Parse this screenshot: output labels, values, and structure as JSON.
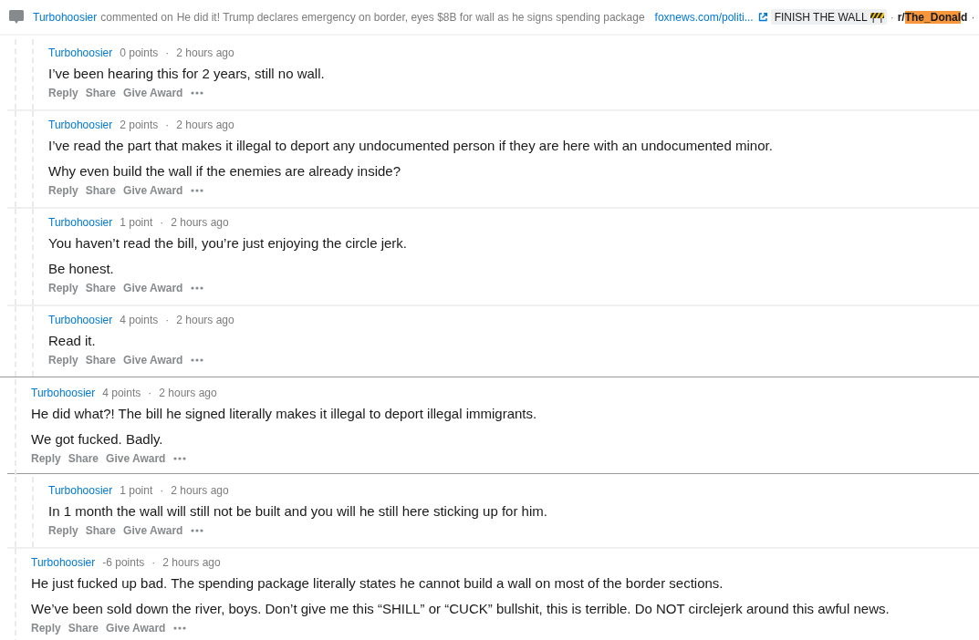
{
  "header": {
    "author": "Turbohoosier",
    "activity": "commented on",
    "post_title": "He did it! Trump declares emergency on border, eyes $8B for wall as he signs spending package",
    "link": "foxnews.com/politi...",
    "flair": "FINISH THE WALL",
    "separator": "·",
    "subreddit": [
      {
        "text": "r/",
        "highlighted": false
      },
      {
        "text": "The_Donal",
        "highlighted": true
      },
      {
        "text": "d",
        "highlighted": false
      }
    ],
    "trailing_separator": "·"
  },
  "comments": [
    {
      "author": "Turbohoosier",
      "score": "0 points",
      "separator": "·",
      "time": "2 hours ago",
      "indented": true,
      "hovered": false,
      "paragraphs": [
        "I’ve been hearing this for 2 years, still no wall."
      ],
      "actions": [
        "Reply",
        "Share",
        "Give Award"
      ]
    },
    {
      "author": "Turbohoosier",
      "score": "2 points",
      "separator": "·",
      "time": "2 hours ago",
      "indented": true,
      "hovered": false,
      "paragraphs": [
        "I’ve read the part that makes it illegal to deport any undocumented person if they are here with an undocumented minor.",
        "Why even build the wall if the enemies are already inside?"
      ],
      "actions": [
        "Reply",
        "Share",
        "Give Award"
      ]
    },
    {
      "author": "Turbohoosier",
      "score": "1 point",
      "separator": "·",
      "time": "2 hours ago",
      "indented": true,
      "hovered": false,
      "paragraphs": [
        "You haven’t read the bill, you’re just enjoying the circle jerk.",
        "Be honest."
      ],
      "actions": [
        "Reply",
        "Share",
        "Give Award"
      ]
    },
    {
      "author": "Turbohoosier",
      "score": "4 points",
      "separator": "·",
      "time": "2 hours ago",
      "indented": true,
      "hovered": false,
      "paragraphs": [
        "Read it."
      ],
      "actions": [
        "Reply",
        "Share",
        "Give Award"
      ]
    },
    {
      "author": "Turbohoosier",
      "score": "4 points",
      "separator": "·",
      "time": "2 hours ago",
      "indented": false,
      "hovered": true,
      "paragraphs": [
        "He did what?! The bill he signed literally makes it illegal to deport illegal immigrants.",
        "We got fucked. Badly."
      ],
      "actions": [
        "Reply",
        "Share",
        "Give Award"
      ]
    },
    {
      "author": "Turbohoosier",
      "score": "1 point",
      "separator": "·",
      "time": "2 hours ago",
      "indented": true,
      "hovered": false,
      "paragraphs": [
        "In 1 month the wall will still not be built and you will he still here sticking up for him."
      ],
      "actions": [
        "Reply",
        "Share",
        "Give Award"
      ]
    },
    {
      "author": "Turbohoosier",
      "score": "-6 points",
      "separator": "·",
      "time": "2 hours ago",
      "indented": false,
      "hovered": false,
      "paragraphs": [
        "He just fucked up bad. The spending package literally states he cannot build a wall on most of the border sections.",
        "We’ve been sold down the river, boys. Don’t give me this “SHILL” or “CUCK” bullshit, this is terrible. Do NOT circlejerk around this awful news."
      ],
      "actions": [
        "Reply",
        "Share",
        "Give Award"
      ]
    }
  ]
}
